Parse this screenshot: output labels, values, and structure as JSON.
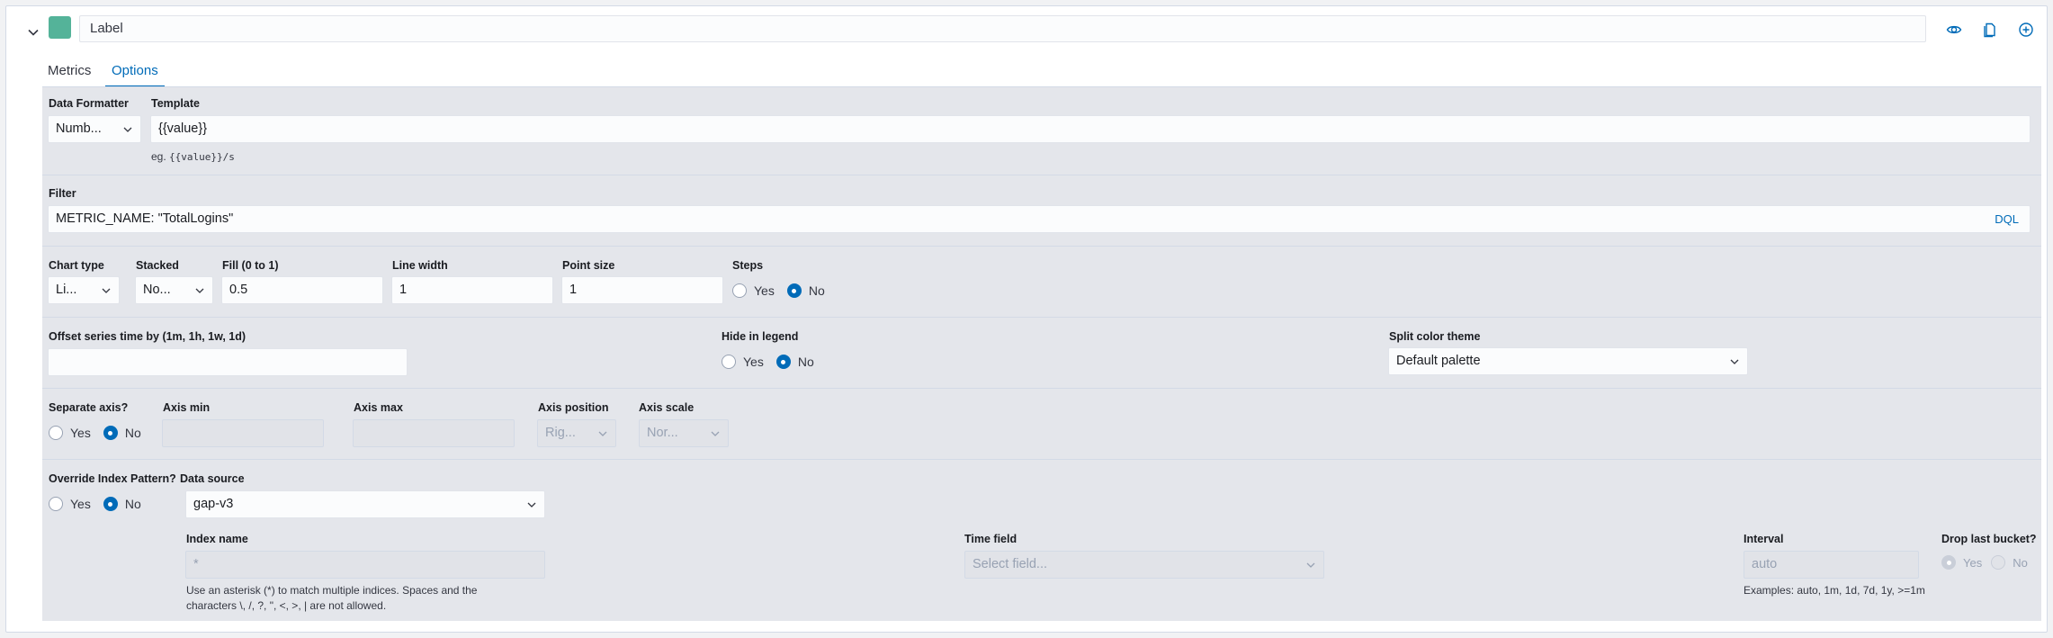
{
  "header": {
    "label_value": "Label",
    "label_placeholder": "Label",
    "swatch_color": "#54b399",
    "icons": [
      "eye-icon",
      "copy-icon",
      "add-icon"
    ]
  },
  "tabs": [
    {
      "label": "Metrics",
      "active": false
    },
    {
      "label": "Options",
      "active": true
    }
  ],
  "formatter": {
    "label": "Data Formatter",
    "value": "Numb..."
  },
  "template": {
    "label": "Template",
    "value": "{{value}}",
    "help_prefix": "eg.",
    "help_example": "{{value}}/s"
  },
  "filter": {
    "label": "Filter",
    "value": "METRIC_NAME: \"TotalLogins\"",
    "language": "DQL"
  },
  "chart": {
    "chart_type_label": "Chart type",
    "chart_type_value": "Li...",
    "stacked_label": "Stacked",
    "stacked_value": "No...",
    "fill_label": "Fill (0 to 1)",
    "fill_value": "0.5",
    "line_width_label": "Line width",
    "line_width_value": "1",
    "point_size_label": "Point size",
    "point_size_value": "1",
    "steps_label": "Steps",
    "steps_yes": "Yes",
    "steps_no": "No",
    "steps_selected": "No"
  },
  "offset": {
    "label": "Offset series time by (1m, 1h, 1w, 1d)",
    "value": ""
  },
  "legend": {
    "label": "Hide in legend",
    "yes": "Yes",
    "no": "No",
    "selected": "No"
  },
  "split_color": {
    "label": "Split color theme",
    "value": "Default palette"
  },
  "axis": {
    "separate_label": "Separate axis?",
    "separate_yes": "Yes",
    "separate_no": "No",
    "separate_selected": "No",
    "min_label": "Axis min",
    "max_label": "Axis max",
    "position_label": "Axis position",
    "position_value": "Rig...",
    "scale_label": "Axis scale",
    "scale_value": "Nor..."
  },
  "index": {
    "override_label": "Override Index Pattern?",
    "override_yes": "Yes",
    "override_no": "No",
    "override_selected": "No",
    "datasource_label": "Data source",
    "datasource_value": "gap-v3",
    "index_name_label": "Index name",
    "index_name_placeholder": "*",
    "index_help_line1": "Use an asterisk (*) to match multiple indices. Spaces and the",
    "index_help_line2": "characters \\, /, ?, \", <, >, | are not allowed.",
    "time_field_label": "Time field",
    "time_field_placeholder": "Select field...",
    "interval_label": "Interval",
    "interval_placeholder": "auto",
    "interval_help": "Examples: auto, 1m, 1d, 7d, 1y, >=1m",
    "drop_label": "Drop last bucket?",
    "drop_yes": "Yes",
    "drop_no": "No",
    "drop_selected": "Yes"
  },
  "colors": {
    "accent": "#006bb8",
    "content_bg": "#e4e6eb",
    "swatch": "#54b399"
  }
}
